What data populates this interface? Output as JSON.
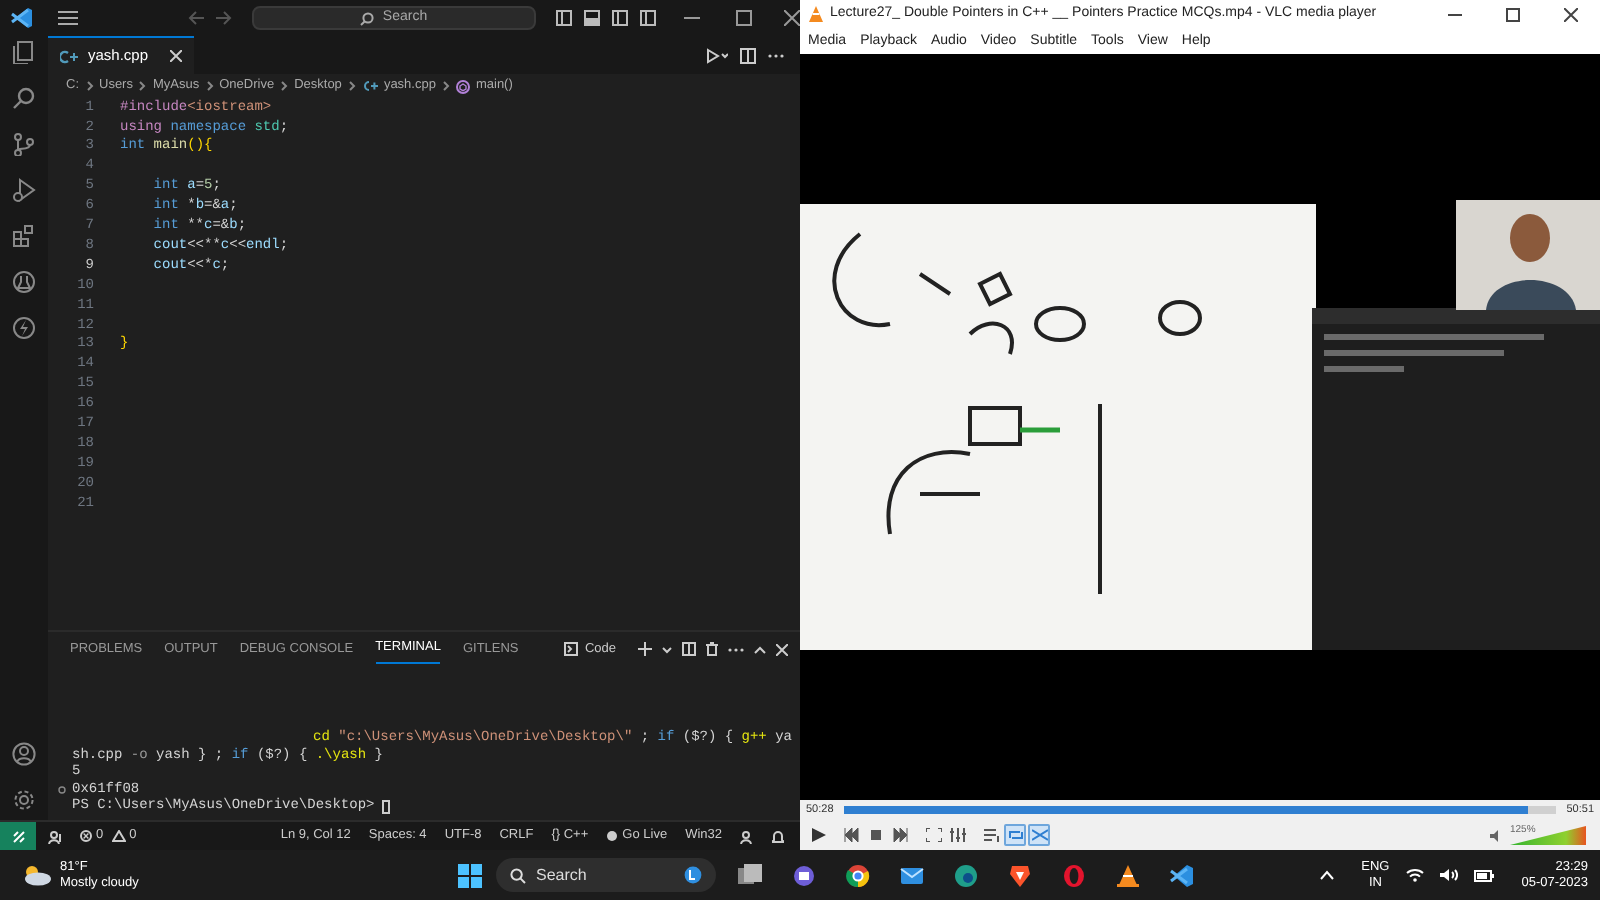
{
  "vscode": {
    "title_search": "Search",
    "tabs": [
      {
        "label": "yash.cpp",
        "selected": true
      }
    ],
    "breadcrumbs": [
      "C:",
      "Users",
      "MyAsus",
      "OneDrive",
      "Desktop",
      "yash.cpp",
      "main()"
    ],
    "lines": [
      {
        "number": "1",
        "current": false,
        "tokens": [
          {
            "kind": "directive",
            "text": "#include"
          },
          {
            "kind": "string",
            "text": "<iostream>"
          }
        ]
      },
      {
        "number": "2",
        "current": false,
        "tokens": [
          {
            "kind": "control",
            "text": "using"
          },
          {
            "kind": "keyword",
            "text": " namespace"
          },
          {
            "kind": "type",
            "text": " std"
          },
          {
            "kind": "plain",
            "text": ";"
          }
        ]
      },
      {
        "number": "3",
        "current": false,
        "tokens": [
          {
            "kind": "keyword",
            "text": "int"
          },
          {
            "kind": "function",
            "text": " main"
          },
          {
            "kind": "bracket",
            "text": "(){"
          }
        ]
      },
      {
        "number": "4",
        "current": false
      },
      {
        "number": "5",
        "current": false,
        "tokens": [
          {
            "kind": "keyword",
            "text": "    int"
          },
          {
            "kind": "variable",
            "text": " a"
          },
          {
            "kind": "plain",
            "text": "="
          },
          {
            "kind": "number",
            "text": "5"
          },
          {
            "kind": "plain",
            "text": ";"
          }
        ]
      },
      {
        "number": "6",
        "current": false,
        "tokens": [
          {
            "kind": "keyword",
            "text": "    int"
          },
          {
            "kind": "plain",
            "text": " *"
          },
          {
            "kind": "variable",
            "text": "b"
          },
          {
            "kind": "plain",
            "text": "=&"
          },
          {
            "kind": "variable",
            "text": "a"
          },
          {
            "kind": "plain",
            "text": ";"
          }
        ]
      },
      {
        "number": "7",
        "current": false,
        "tokens": [
          {
            "kind": "keyword",
            "text": "    int"
          },
          {
            "kind": "plain",
            "text": " **"
          },
          {
            "kind": "variable",
            "text": "c"
          },
          {
            "kind": "plain",
            "text": "=&"
          },
          {
            "kind": "variable",
            "text": "b"
          },
          {
            "kind": "plain",
            "text": ";"
          }
        ]
      },
      {
        "number": "8",
        "current": false,
        "tokens": [
          {
            "kind": "variable",
            "text": "    cout"
          },
          {
            "kind": "plain",
            "text": "<<**"
          },
          {
            "kind": "variable",
            "text": "c"
          },
          {
            "kind": "plain",
            "text": "<<"
          },
          {
            "kind": "variable",
            "text": "endl"
          },
          {
            "kind": "plain",
            "text": ";"
          }
        ]
      },
      {
        "number": "9",
        "current": true,
        "tokens": [
          {
            "kind": "variable",
            "text": "    cout"
          },
          {
            "kind": "plain",
            "text": "<<*"
          },
          {
            "kind": "variable",
            "text": "c"
          },
          {
            "kind": "plain",
            "text": ";"
          }
        ]
      },
      {
        "number": "10",
        "current": false
      },
      {
        "number": "11",
        "current": false
      },
      {
        "number": "12",
        "current": false
      },
      {
        "number": "13",
        "current": false,
        "tokens": [
          {
            "kind": "bracket",
            "text": "}"
          }
        ]
      },
      {
        "number": "14",
        "current": false
      },
      {
        "number": "15",
        "current": false
      },
      {
        "number": "16",
        "current": false
      },
      {
        "number": "17",
        "current": false
      },
      {
        "number": "18",
        "current": false
      },
      {
        "number": "19",
        "current": false
      },
      {
        "number": "20",
        "current": false
      },
      {
        "number": "21",
        "current": false
      }
    ],
    "panel_tabs": [
      {
        "label": "PROBLEMS",
        "selected": false
      },
      {
        "label": "OUTPUT",
        "selected": false
      },
      {
        "label": "DEBUG CONSOLE",
        "selected": false
      },
      {
        "label": "TERMINAL",
        "selected": true
      },
      {
        "label": "GITLENS",
        "selected": false
      }
    ],
    "terminal_profile": "Code",
    "terminal": [
      {
        "kind": "wrapped",
        "tokens": [
          {
            "kind": "command",
            "text": "cd"
          },
          {
            "kind": "string",
            "text": " \"c:\\Users\\MyAsus\\OneDrive\\Desktop\\\""
          },
          {
            "kind": "plain",
            "text": " ; "
          },
          {
            "kind": "keyword",
            "text": "if"
          },
          {
            "kind": "plain",
            "text": " ($?) { "
          },
          {
            "kind": "command",
            "text": "g++"
          },
          {
            "kind": "plain",
            "text": " ya"
          }
        ]
      },
      {
        "kind": "output",
        "tokens": [
          {
            "kind": "plain",
            "text": "sh.cpp"
          },
          {
            "kind": "param",
            "text": " -o"
          },
          {
            "kind": "plain",
            "text": " yash } ; "
          },
          {
            "kind": "keyword",
            "text": "if"
          },
          {
            "kind": "plain",
            "text": " ($?) { "
          },
          {
            "kind": "command",
            "text": ".\\yash"
          },
          {
            "kind": "plain",
            "text": " }"
          }
        ]
      },
      {
        "kind": "output",
        "tokens": [
          {
            "kind": "plain",
            "text": "5"
          }
        ]
      },
      {
        "kind": "marked",
        "tokens": [
          {
            "kind": "plain",
            "text": "0x61ff08"
          }
        ]
      },
      {
        "kind": "prompt",
        "tokens": [
          {
            "kind": "plain",
            "text": "PS C:\\Users\\MyAsus\\OneDrive\\Desktop> "
          }
        ]
      }
    ],
    "status": {
      "errors": "0",
      "warnings": "0",
      "items": [
        "Ln 9, Col 12",
        "Spaces: 4",
        "UTF-8",
        "CRLF",
        "{} C++",
        "Go Live",
        "Win32"
      ]
    }
  },
  "vlc": {
    "title": "Lecture27_ Double Pointers in C++ __ Pointers Practice MCQs.mp4 - VLC media player",
    "menu": [
      "Media",
      "Playback",
      "Audio",
      "Video",
      "Subtitle",
      "Tools",
      "View",
      "Help"
    ],
    "elapsed": "50:28",
    "total": "50:51",
    "seek": {
      "level": 0.96
    },
    "loop": {
      "on": true
    },
    "random": {
      "on": true
    },
    "volume_reading": "125%",
    "volume": {
      "level": 1
    }
  },
  "taskbar": {
    "temperature": "81°F",
    "weather": "Mostly cloudy",
    "search": "Search",
    "language": "ENG",
    "region": "IN",
    "time": "23:29",
    "date": "05-07-2023"
  }
}
